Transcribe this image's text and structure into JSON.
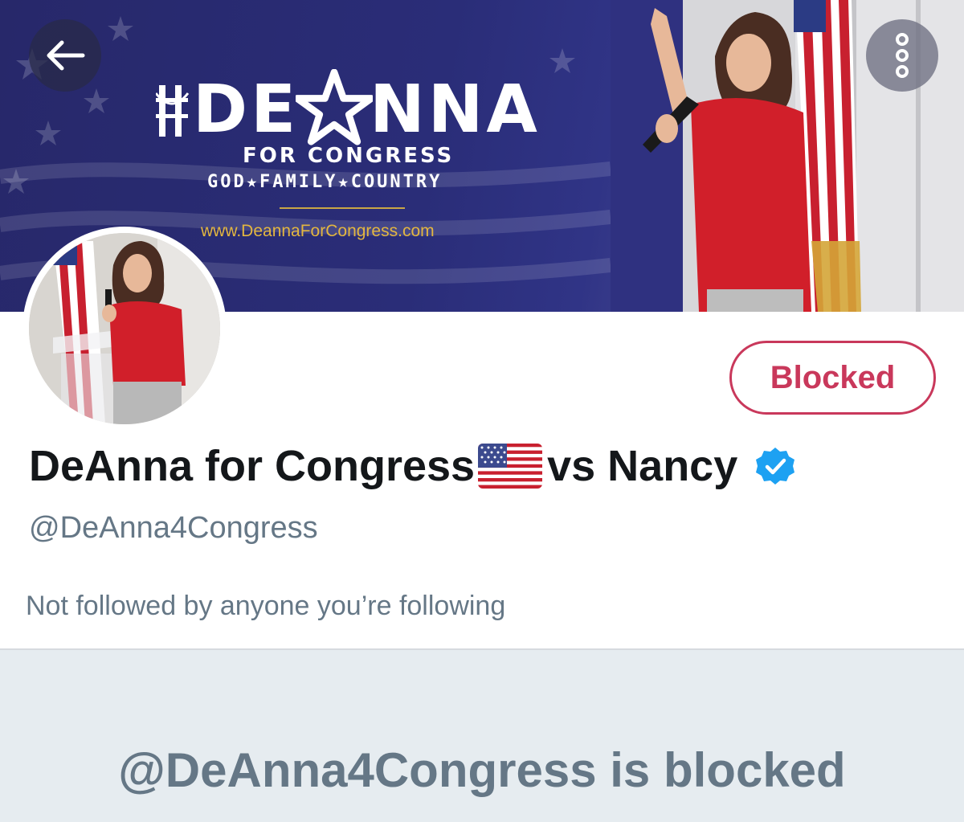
{
  "banner": {
    "logo_title_left": "DE",
    "logo_title_right": "NNA",
    "logo_subtitle": "FOR CONGRESS",
    "logo_tagline": "GOD★FAMILY★COUNTRY",
    "logo_url": "www.DeannaForCongress.com"
  },
  "nav": {
    "back_icon": "arrow-left-icon",
    "more_icon": "more-vertical-icon"
  },
  "profile": {
    "name_part1": "DeAnna for Congress",
    "name_part2": "vs Nancy",
    "handle": "@DeAnna4Congress",
    "followers_note": "Not followed by anyone you’re following",
    "blocked_label": "Blocked",
    "verified_icon": "verified-badge-icon"
  },
  "blocked_notice": {
    "message": "@DeAnna4Congress is blocked"
  },
  "colors": {
    "banner_navy": "#2a2d78",
    "blocked_red": "#c9385b",
    "secondary_text": "#657786",
    "verified_blue": "#1da1f2",
    "panel_bg": "#e6ecf0"
  }
}
